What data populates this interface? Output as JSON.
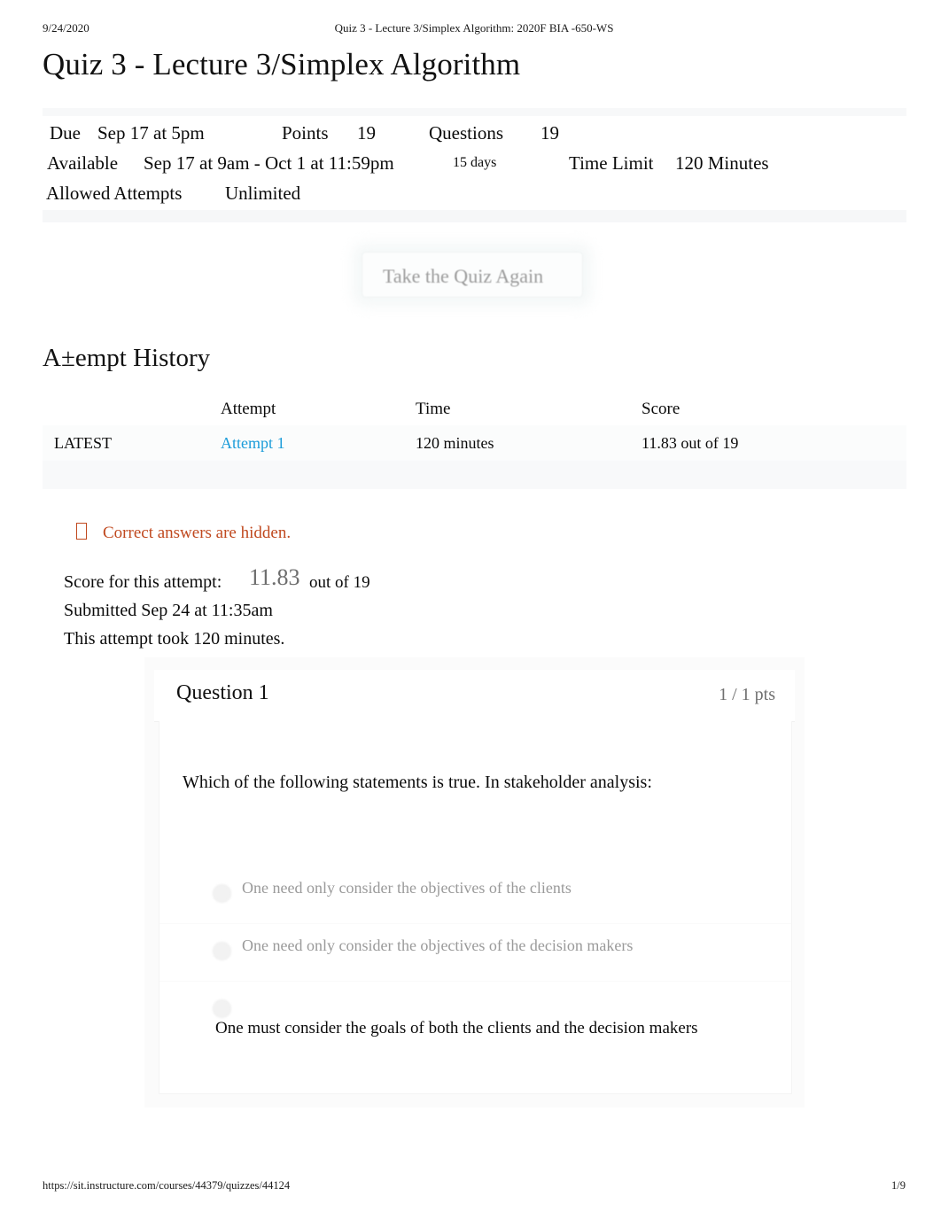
{
  "print_header": {
    "date": "9/24/2020",
    "title": "Quiz 3 - Lecture 3/Simplex Algorithm: 2020F BIA -650-WS"
  },
  "print_footer": {
    "url": "https://sit.instructure.com/courses/44379/quizzes/44124",
    "page": "1/9"
  },
  "quiz": {
    "title": "Quiz 3 - Lecture 3/Simplex Algorithm"
  },
  "meta": {
    "due_label": "Due",
    "due_value": "Sep 17 at 5pm",
    "points_label": "Points",
    "points_value": "19",
    "questions_label": "Questions",
    "questions_value": "19",
    "available_label": "Available",
    "available_value": "Sep 17 at 9am - Oct 1 at 11:59pm",
    "available_days": "15 days",
    "time_limit_label": "Time Limit",
    "time_limit_value": "120 Minutes",
    "attempts_label": "Allowed Attempts",
    "attempts_value": "Unlimited"
  },
  "retake": {
    "label": "Take the Quiz Again"
  },
  "history": {
    "title": "A±empt History",
    "columns": [
      "",
      "Attempt",
      "Time",
      "Score"
    ],
    "rows": [
      {
        "marker": "LATEST",
        "attempt": "Attempt 1",
        "time": "120 minutes",
        "score": "11.83 out of 19"
      }
    ]
  },
  "notice": {
    "icon": "missing-glyph-box-icon",
    "text": "Correct answers are hidden."
  },
  "attempt_summary": {
    "score_label": "Score for this attempt:",
    "score_value": "11.83",
    "score_outof": "out of 19",
    "submitted": "Submitted Sep 24 at 11:35am",
    "duration": "This attempt took 120 minutes."
  },
  "question": {
    "number_label": "Question 1",
    "points_label": "1 / 1 pts",
    "text": "Which of the following statements is true. In stakeholder analysis:",
    "options": [
      {
        "label": "One need only consider the objectives of the clients",
        "selected": false
      },
      {
        "label": "One need only consider the objectives of the decision makers",
        "selected": false
      },
      {
        "label": "One must consider the goals of both the clients and the decision makers",
        "selected": true
      }
    ]
  },
  "colors": {
    "link": "#1b9cd9",
    "notice": "#c0491f",
    "muted": "#6f6f6f"
  }
}
